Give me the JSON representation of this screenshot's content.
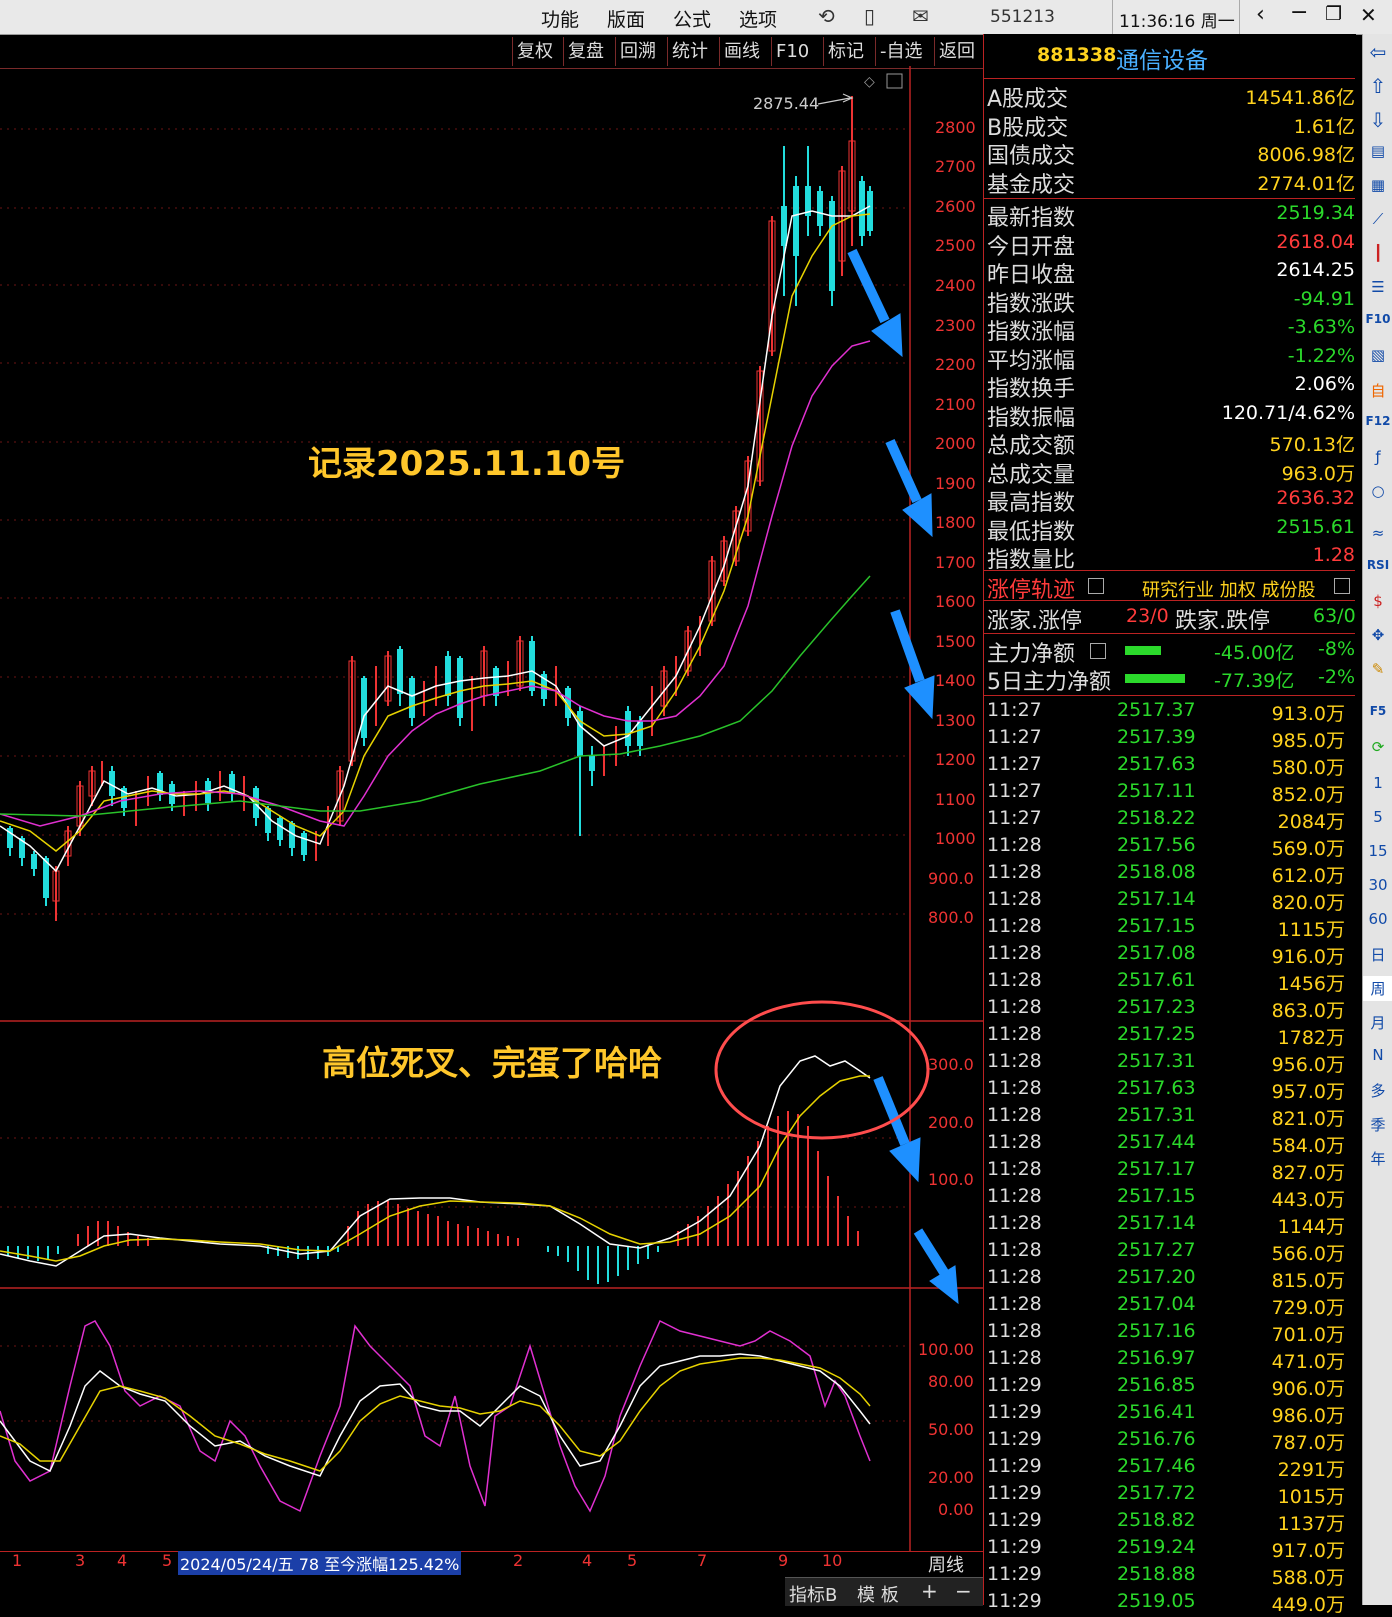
{
  "topbar": {
    "menus": [
      "功能",
      "版面",
      "公式",
      "选项"
    ],
    "code": "551213",
    "time": "11:36:16 周一"
  },
  "chart_toolbar": [
    "复权",
    "复盘",
    "回溯",
    "统计",
    "画线",
    "F10",
    "标记",
    "-自选",
    "返回"
  ],
  "main_chart": {
    "peak_label": "2875.44",
    "price_axis": [
      "2800",
      "2700",
      "2600",
      "2500",
      "2400",
      "2300",
      "2200",
      "2100",
      "2000",
      "1900",
      "1800",
      "1700",
      "1600",
      "1500",
      "1400",
      "1300",
      "1200",
      "1100",
      "1000",
      "900.0",
      "800.0"
    ],
    "annotation_1": "记录2025.11.10号",
    "annotation_2": "高位死叉、完蛋了哈哈"
  },
  "macd_axis": [
    "300.0",
    "200.0",
    "100.0"
  ],
  "kdj_axis": [
    "100.00",
    "80.00",
    "50.00",
    "20.00",
    "0.00"
  ],
  "bottom_axis": {
    "ticks": [
      "1",
      "3",
      "4",
      "5",
      "2",
      "4",
      "5",
      "7",
      "9",
      "10"
    ],
    "range_info": "2024/05/24/五 78 至今涨幅125.42%",
    "period": "周线",
    "buttons": [
      "指标B",
      "模 板",
      "+",
      "−"
    ]
  },
  "panel": {
    "code": "881338",
    "name": "通信设备",
    "market": [
      {
        "label": "A股成交",
        "value": "14541.86亿"
      },
      {
        "label": "B股成交",
        "value": "1.61亿"
      },
      {
        "label": "国债成交",
        "value": "8006.98亿"
      },
      {
        "label": "基金成交",
        "value": "2774.01亿"
      }
    ],
    "stats": [
      {
        "label": "最新指数",
        "value": "2519.34",
        "color": "#2bd92b"
      },
      {
        "label": "今日开盘",
        "value": "2618.04",
        "color": "#ff3b3b"
      },
      {
        "label": "昨日收盘",
        "value": "2614.25",
        "color": "#ffffff"
      },
      {
        "label": "指数涨跌",
        "value": "-94.91",
        "color": "#2bd92b"
      },
      {
        "label": "指数涨幅",
        "value": "-3.63%",
        "color": "#2bd92b"
      },
      {
        "label": "平均涨幅",
        "value": "-1.22%",
        "color": "#2bd92b"
      },
      {
        "label": "指数换手",
        "value": "2.06%",
        "color": "#ffffff"
      },
      {
        "label": "指数振幅",
        "value": "120.71/4.62%",
        "color": "#ffffff"
      },
      {
        "label": "总成交额",
        "value": "570.13亿",
        "color": "#ffd21e"
      },
      {
        "label": "总成交量",
        "value": "963.0万",
        "color": "#ffd21e"
      },
      {
        "label": "最高指数",
        "value": "2636.32",
        "color": "#ff3b3b"
      },
      {
        "label": "最低指数",
        "value": "2515.61",
        "color": "#2bd92b"
      },
      {
        "label": "指数量比",
        "value": "1.28",
        "color": "#ff3b3b"
      }
    ],
    "limit_title": "涨停轨迹",
    "limit_links": "研究行业 加权 成份股",
    "limit_row": {
      "label1": "涨家.涨停",
      "val1": "23/0",
      "label2": "跌家.跌停",
      "val2": "63/0"
    },
    "flow": [
      {
        "label": "主力净额",
        "value": "-45.00亿",
        "pct": "-8%"
      },
      {
        "label": "5日主力净额",
        "value": "-77.39亿",
        "pct": "-2%"
      }
    ],
    "ticks": [
      [
        "11:27",
        "2517.37",
        "913.0万"
      ],
      [
        "11:27",
        "2517.39",
        "985.0万"
      ],
      [
        "11:27",
        "2517.63",
        "580.0万"
      ],
      [
        "11:27",
        "2517.11",
        "852.0万"
      ],
      [
        "11:27",
        "2518.22",
        "2084万"
      ],
      [
        "11:28",
        "2517.56",
        "569.0万"
      ],
      [
        "11:28",
        "2518.08",
        "612.0万"
      ],
      [
        "11:28",
        "2517.14",
        "820.0万"
      ],
      [
        "11:28",
        "2517.15",
        "1115万"
      ],
      [
        "11:28",
        "2517.08",
        "916.0万"
      ],
      [
        "11:28",
        "2517.61",
        "1456万"
      ],
      [
        "11:28",
        "2517.23",
        "863.0万"
      ],
      [
        "11:28",
        "2517.25",
        "1782万"
      ],
      [
        "11:28",
        "2517.31",
        "956.0万"
      ],
      [
        "11:28",
        "2517.63",
        "957.0万"
      ],
      [
        "11:28",
        "2517.31",
        "821.0万"
      ],
      [
        "11:28",
        "2517.44",
        "584.0万"
      ],
      [
        "11:28",
        "2517.17",
        "827.0万"
      ],
      [
        "11:28",
        "2517.15",
        "443.0万"
      ],
      [
        "11:28",
        "2517.14",
        "1144万"
      ],
      [
        "11:28",
        "2517.27",
        "566.0万"
      ],
      [
        "11:28",
        "2517.20",
        "815.0万"
      ],
      [
        "11:28",
        "2517.04",
        "729.0万"
      ],
      [
        "11:28",
        "2517.16",
        "701.0万"
      ],
      [
        "11:28",
        "2516.97",
        "471.0万"
      ],
      [
        "11:29",
        "2516.85",
        "906.0万"
      ],
      [
        "11:29",
        "2516.41",
        "986.0万"
      ],
      [
        "11:29",
        "2516.76",
        "787.0万"
      ],
      [
        "11:29",
        "2517.46",
        "2291万"
      ],
      [
        "11:29",
        "2517.72",
        "1015万"
      ],
      [
        "11:29",
        "2518.82",
        "1137万"
      ],
      [
        "11:29",
        "2519.24",
        "917.0万"
      ],
      [
        "11:29",
        "2518.88",
        "588.0万"
      ],
      [
        "11:29",
        "2519.05",
        "449.0万"
      ]
    ]
  },
  "right_toolbar": [
    "1",
    "5",
    "15",
    "30",
    "60",
    "日",
    "周",
    "月",
    "N",
    "多",
    "季",
    "年"
  ]
}
